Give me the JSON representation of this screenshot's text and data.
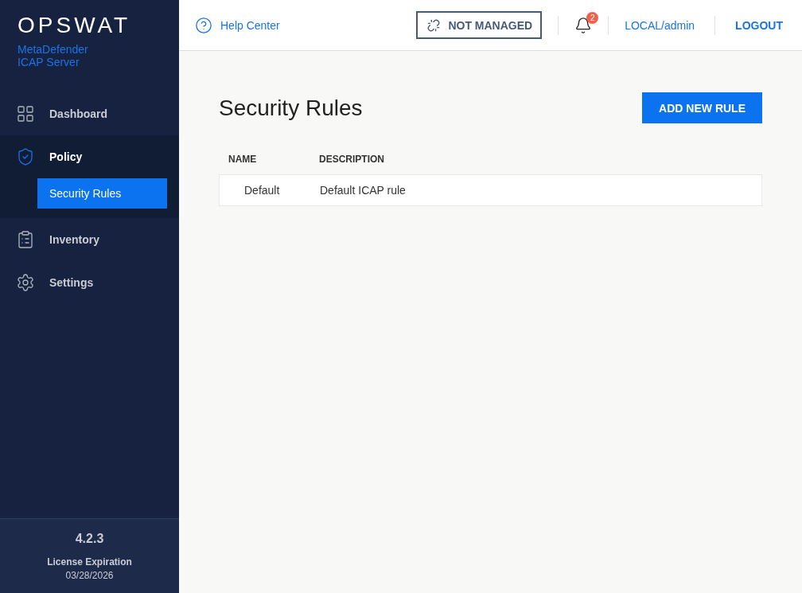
{
  "brand": {
    "logo": "OPSWAT",
    "tagline": "MetaDefender",
    "product": "ICAP Server"
  },
  "sidebar": {
    "items": [
      {
        "label": "Dashboard",
        "expanded": false
      },
      {
        "label": "Policy",
        "expanded": true,
        "children": [
          {
            "label": "Security Rules",
            "selected": true
          }
        ]
      },
      {
        "label": "Inventory",
        "expanded": false
      },
      {
        "label": "Settings",
        "expanded": false
      }
    ],
    "version": "4.2.3",
    "license_label": "License Expiration",
    "license_date": "03/28/2026"
  },
  "header": {
    "help": "Help Center",
    "status": "NOT MANAGED",
    "notifications": "2",
    "user": "LOCAL/admin",
    "logout": "LOGOUT"
  },
  "page": {
    "title": "Security Rules",
    "add_button": "ADD NEW RULE",
    "table": {
      "columns": [
        "NAME",
        "DESCRIPTION"
      ],
      "rows": [
        {
          "name": "Default",
          "description": "Default ICAP rule"
        }
      ]
    }
  }
}
